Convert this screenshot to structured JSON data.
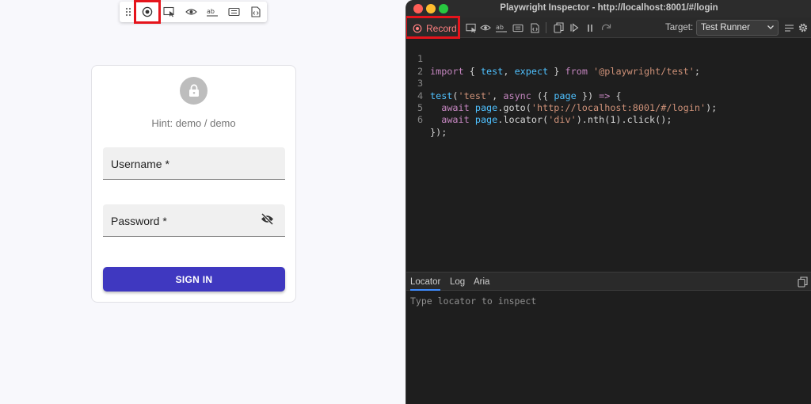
{
  "login": {
    "hint": "Hint: demo / demo",
    "username_label": "Username *",
    "password_label": "Password *",
    "signin_label": "SIGN IN"
  },
  "page_toolbar": {
    "items": [
      "drag-handle-icon",
      "record-icon",
      "pick-locator-icon",
      "assert-visibility-icon",
      "assert-text-icon",
      "assert-value-icon",
      "assert-snapshot-icon"
    ]
  },
  "inspector": {
    "window_title": "Playwright Inspector - http://localhost:8001/#/login",
    "record_label": "Record",
    "target_label": "Target:",
    "target_value": "Test Runner",
    "tabs": [
      "Locator",
      "Log",
      "Aria"
    ],
    "locator_placeholder": "Type locator to inspect",
    "line_numbers": [
      "1",
      "2",
      "3",
      "4",
      "5",
      "6"
    ],
    "code_lines": [
      "import { test, expect } from '@playwright/test';",
      "",
      "test('test', async ({ page }) => {",
      "  await page.goto('http://localhost:8001/#/login');",
      "  await page.locator('div').nth(1).click();",
      "});"
    ],
    "colors": {
      "keyword": "#c586c0",
      "identifier": "#4fc1ff",
      "string": "#ce9178",
      "record_text": "#ff8080",
      "highlight": "#e5141c"
    }
  }
}
